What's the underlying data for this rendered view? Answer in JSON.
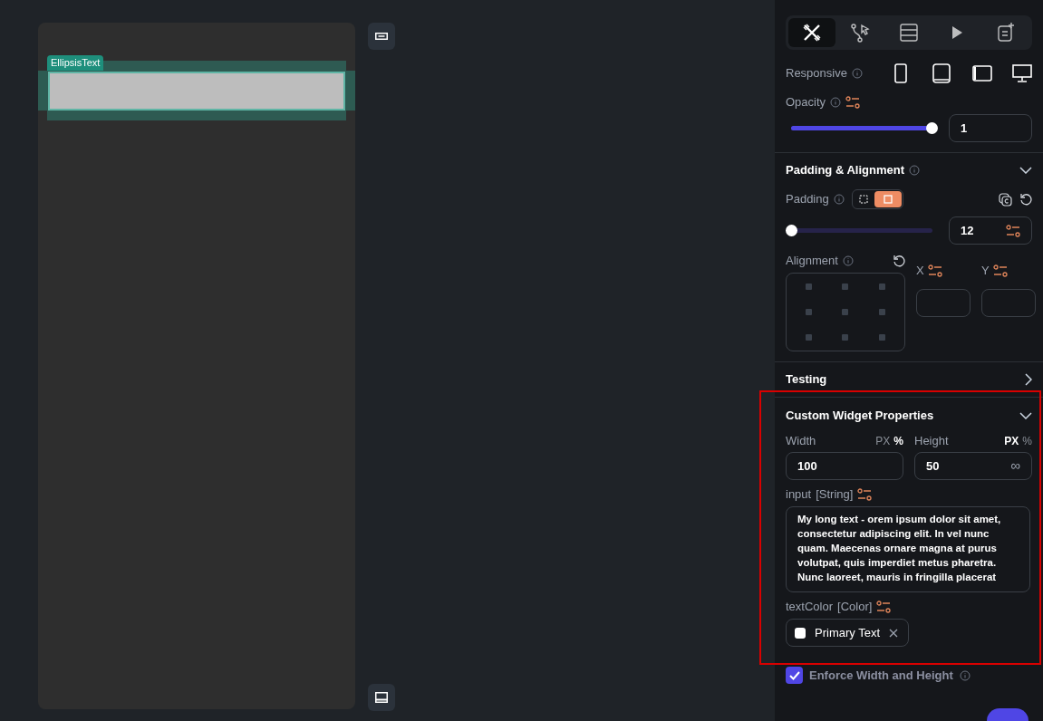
{
  "canvas": {
    "widget_label": "EllipsisText"
  },
  "tool_tabs": [
    {
      "kind": "design",
      "selected": true
    },
    {
      "kind": "logic",
      "selected": false
    },
    {
      "kind": "backend",
      "selected": false
    },
    {
      "kind": "run",
      "selected": false
    },
    {
      "kind": "docs",
      "selected": false
    }
  ],
  "responsive": {
    "label": "Responsive"
  },
  "opacity": {
    "label": "Opacity",
    "level": 1,
    "value": "1"
  },
  "padding_alignment": {
    "title": "Padding & Alignment",
    "expanded": true,
    "padding": {
      "label": "Padding",
      "modes": [
        {
          "selected": false
        },
        {
          "selected": true
        }
      ],
      "level": 0,
      "value": "12"
    },
    "alignment": {
      "label": "Alignment",
      "x_label": "X",
      "y_label": "Y"
    }
  },
  "testing": {
    "title": "Testing",
    "expanded": false
  },
  "custom_widget_properties": {
    "title": "Custom Widget Properties",
    "expanded": true,
    "width": {
      "label": "Width",
      "units": [
        {
          "label": "PX",
          "selected": false
        },
        {
          "label": "%",
          "selected": true
        }
      ],
      "value": "100"
    },
    "height": {
      "label": "Height",
      "units": [
        {
          "label": "PX",
          "selected": true
        },
        {
          "label": "%",
          "selected": false
        }
      ],
      "value": "50",
      "suffix": "∞"
    },
    "input": {
      "label": "input",
      "type": "[String]",
      "value": "My long text - orem ipsum dolor sit amet, consectetur adipiscing elit. In vel nunc quam. Maecenas ornare magna at purus volutpat, quis imperdiet metus pharetra. Nunc laoreet, mauris in fringilla placerat"
    },
    "text_color": {
      "label": "textColor",
      "type": "[Color]",
      "value": "Primary Text",
      "color": "#ffffff"
    }
  },
  "enforce_width_height": {
    "label": "Enforce Width and Height",
    "checked": true
  }
}
